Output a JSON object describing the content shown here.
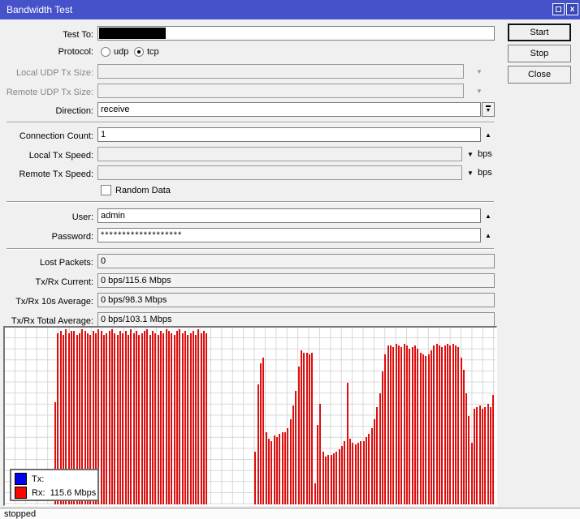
{
  "window": {
    "title": "Bandwidth Test",
    "status": "stopped"
  },
  "titlebar": {
    "maximize_icon": "maximize",
    "close_icon": "x"
  },
  "action_buttons": {
    "start": "Start",
    "stop": "Stop",
    "close": "Close"
  },
  "form": {
    "test_to": {
      "label": "Test To:",
      "value": "",
      "redacted": true
    },
    "protocol": {
      "label": "Protocol:",
      "options": [
        {
          "label": "udp",
          "selected": false
        },
        {
          "label": "tcp",
          "selected": true
        }
      ]
    },
    "local_udp_tx_size": {
      "label": "Local UDP Tx Size:",
      "value": "",
      "disabled": true
    },
    "remote_udp_tx_size": {
      "label": "Remote UDP Tx Size:",
      "value": "",
      "disabled": true
    },
    "direction": {
      "label": "Direction:",
      "value": "receive"
    },
    "connection_count": {
      "label": "Connection Count:",
      "value": "1"
    },
    "local_tx_speed": {
      "label": "Local Tx Speed:",
      "value": "",
      "unit": "bps",
      "disabled": true
    },
    "remote_tx_speed": {
      "label": "Remote Tx Speed:",
      "value": "",
      "unit": "bps",
      "disabled": true
    },
    "random_data": {
      "label": "Random Data",
      "checked": false
    },
    "user": {
      "label": "User:",
      "value": "admin"
    },
    "password": {
      "label": "Password:",
      "value": "*******************"
    },
    "lost_packets": {
      "label": "Lost Packets:",
      "value": "0"
    },
    "txrx_current": {
      "label": "Tx/Rx Current:",
      "value": "0 bps/115.6 Mbps"
    },
    "txrx_10s_avg": {
      "label": "Tx/Rx 10s Average:",
      "value": "0 bps/98.3 Mbps"
    },
    "txrx_total_avg": {
      "label": "Tx/Rx Total Average:",
      "value": "0 bps/103.1 Mbps"
    }
  },
  "legend": {
    "tx_label": "Tx:",
    "tx_value": "",
    "rx_label": "Rx:",
    "rx_value": "115.6 Mbps",
    "tx_color": "#0000f0",
    "rx_color": "#f50800"
  },
  "chart_data": {
    "type": "bar",
    "title": "",
    "xlabel": "",
    "ylabel": "",
    "grid": true,
    "legend_position": "bottom-left",
    "series_name": "Rx",
    "bar_color": "#dd0f0f",
    "note": "values are bar heights as fraction of plot height; axis unlabeled in UI; Rx current 115.6 Mbps, 10s avg 98.3 Mbps, total avg 103.1 Mbps; Tx is 0 bps (no blue bars)",
    "values": [
      0.58,
      0.97,
      0.98,
      0.96,
      0.99,
      0.97,
      0.98,
      0.98,
      0.96,
      0.97,
      0.99,
      0.98,
      0.97,
      0.96,
      0.98,
      0.97,
      0.99,
      0.98,
      0.96,
      0.97,
      0.98,
      0.99,
      0.97,
      0.96,
      0.98,
      0.97,
      0.98,
      0.96,
      0.99,
      0.97,
      0.98,
      0.96,
      0.97,
      0.98,
      0.99,
      0.96,
      0.98,
      0.97,
      0.96,
      0.98,
      0.97,
      0.99,
      0.98,
      0.97,
      0.96,
      0.98,
      0.99,
      0.97,
      0.98,
      0.96,
      0.97,
      0.98,
      0.96,
      0.99,
      0.97,
      0.98,
      0.97,
      0,
      0,
      0,
      0,
      0,
      0,
      0,
      0,
      0,
      0,
      0,
      0,
      0,
      0,
      0,
      0,
      0,
      0.3,
      0.68,
      0.8,
      0.83,
      0.41,
      0.37,
      0.36,
      0.39,
      0.38,
      0.4,
      0.41,
      0.41,
      0.43,
      0.48,
      0.56,
      0.64,
      0.78,
      0.87,
      0.86,
      0.86,
      0.85,
      0.86,
      0.12,
      0.45,
      0.57,
      0.3,
      0.27,
      0.28,
      0.28,
      0.29,
      0.3,
      0.31,
      0.33,
      0.36,
      0.69,
      0.37,
      0.35,
      0.34,
      0.35,
      0.36,
      0.36,
      0.38,
      0.4,
      0.43,
      0.48,
      0.55,
      0.63,
      0.75,
      0.85,
      0.9,
      0.9,
      0.89,
      0.91,
      0.9,
      0.89,
      0.91,
      0.9,
      0.88,
      0.89,
      0.9,
      0.88,
      0.86,
      0.85,
      0.84,
      0.85,
      0.87,
      0.9,
      0.91,
      0.9,
      0.89,
      0.9,
      0.91,
      0.9,
      0.91,
      0.9,
      0.89,
      0.83,
      0.76,
      0.63,
      0.5,
      0.35,
      0.54,
      0.55,
      0.56,
      0.54,
      0.55,
      0.57,
      0.55,
      0.62,
      0.7
    ]
  }
}
